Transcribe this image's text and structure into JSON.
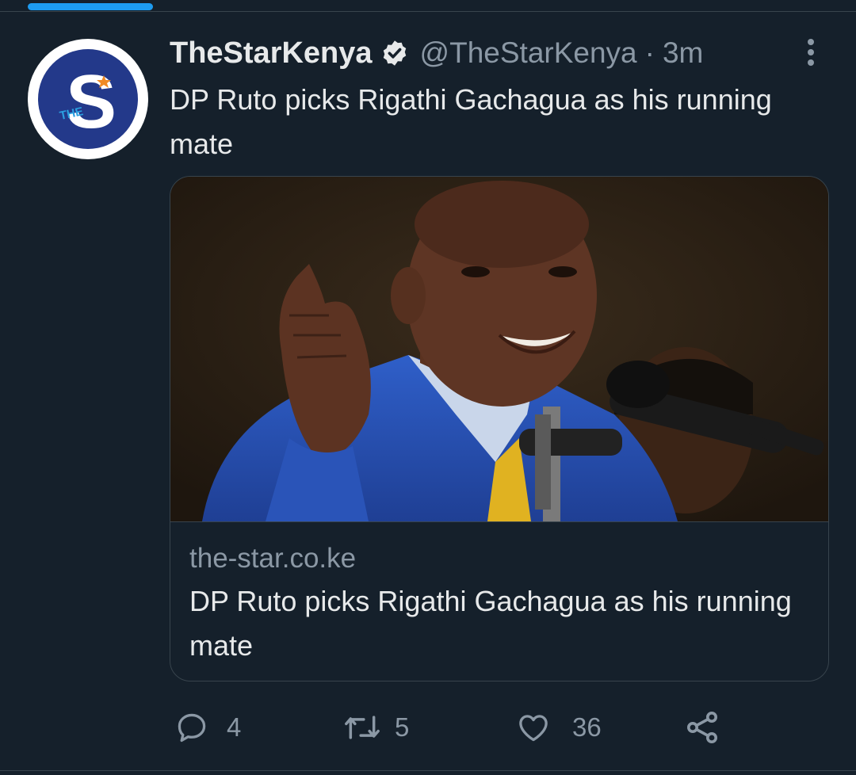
{
  "tweet": {
    "author": {
      "display_name": "TheStarKenya",
      "handle": "@TheStarKenya",
      "verified": true,
      "avatar_letters": "S",
      "avatar_small_text": "THE"
    },
    "separator": "·",
    "timestamp": "3m",
    "text": "DP Ruto picks Rigathi Gachagua as his running mate",
    "card": {
      "domain": "the-star.co.ke",
      "title": "DP Ruto picks Rigathi Gachagua as his running mate"
    },
    "actions": {
      "reply_count": "4",
      "retweet_count": "5",
      "like_count": "36"
    }
  },
  "icons": {
    "verified": "verified-badge-icon",
    "more": "more-options-icon",
    "reply": "reply-icon",
    "retweet": "retweet-icon",
    "like": "heart-icon",
    "share": "share-icon"
  },
  "colors": {
    "background": "#15202b",
    "text_primary": "#e7e9ea",
    "text_secondary": "#8b98a5",
    "accent": "#1d9bf0",
    "border": "#38444d",
    "avatar_brand": "#23398a"
  }
}
